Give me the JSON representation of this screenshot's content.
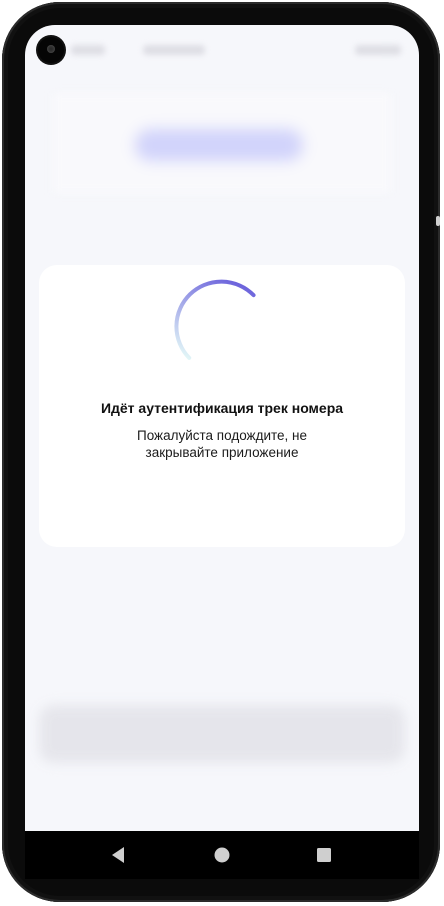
{
  "loading_card": {
    "title": "Идёт аутентификация трек номера",
    "message": "Пожалуйста подождите, не закрывайте приложение"
  },
  "navigation": {
    "back_icon": "back-triangle-icon",
    "home_icon": "home-circle-icon",
    "recents_icon": "recents-square-icon"
  },
  "colors": {
    "screen_background": "#f6f7fb",
    "card_background": "#ffffff",
    "spinner_start": "#5c4fd8",
    "spinner_end": "#e6fbf8",
    "nav_icons": "#cfcfcf"
  }
}
